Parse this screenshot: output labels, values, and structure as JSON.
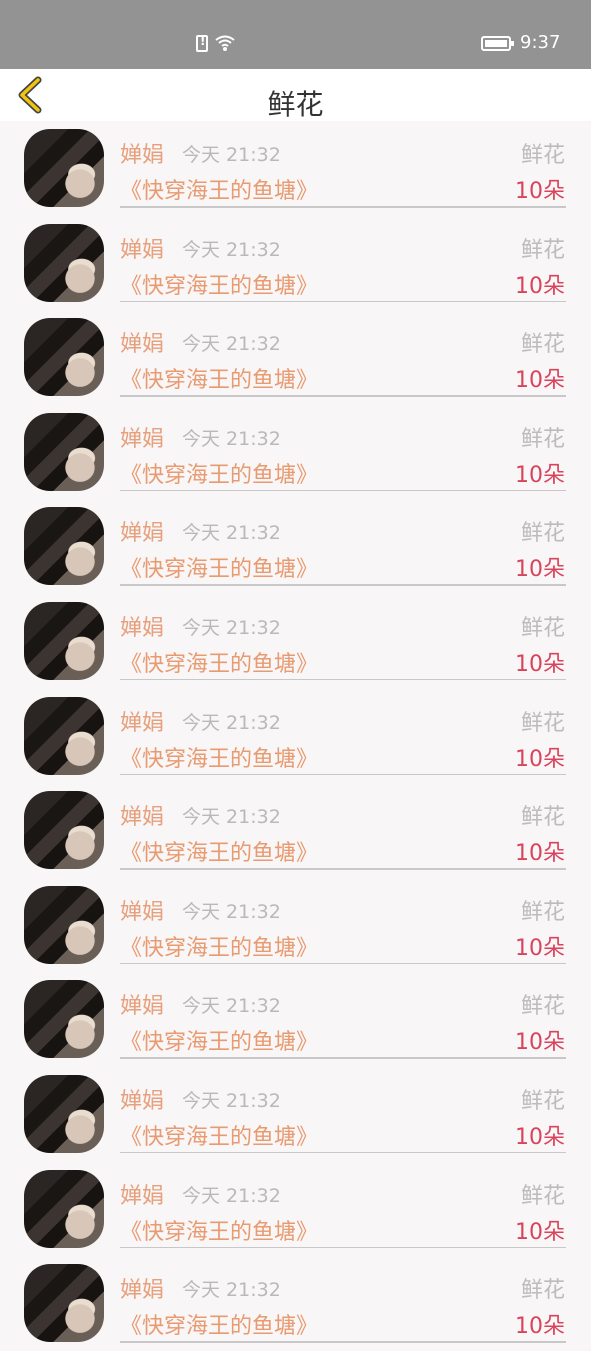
{
  "status": {
    "time": "9:37"
  },
  "header": {
    "title": "鲜花"
  },
  "list": {
    "items": [
      {
        "name": "婵娟",
        "time": "今天 21:32",
        "type": "鲜花",
        "book": "《快穿海王的鱼塘》",
        "count": "10朵"
      },
      {
        "name": "婵娟",
        "time": "今天 21:32",
        "type": "鲜花",
        "book": "《快穿海王的鱼塘》",
        "count": "10朵"
      },
      {
        "name": "婵娟",
        "time": "今天 21:32",
        "type": "鲜花",
        "book": "《快穿海王的鱼塘》",
        "count": "10朵"
      },
      {
        "name": "婵娟",
        "time": "今天 21:32",
        "type": "鲜花",
        "book": "《快穿海王的鱼塘》",
        "count": "10朵"
      },
      {
        "name": "婵娟",
        "time": "今天 21:32",
        "type": "鲜花",
        "book": "《快穿海王的鱼塘》",
        "count": "10朵"
      },
      {
        "name": "婵娟",
        "time": "今天 21:32",
        "type": "鲜花",
        "book": "《快穿海王的鱼塘》",
        "count": "10朵"
      },
      {
        "name": "婵娟",
        "time": "今天 21:32",
        "type": "鲜花",
        "book": "《快穿海王的鱼塘》",
        "count": "10朵"
      },
      {
        "name": "婵娟",
        "time": "今天 21:32",
        "type": "鲜花",
        "book": "《快穿海王的鱼塘》",
        "count": "10朵"
      },
      {
        "name": "婵娟",
        "time": "今天 21:32",
        "type": "鲜花",
        "book": "《快穿海王的鱼塘》",
        "count": "10朵"
      },
      {
        "name": "婵娟",
        "time": "今天 21:32",
        "type": "鲜花",
        "book": "《快穿海王的鱼塘》",
        "count": "10朵"
      },
      {
        "name": "婵娟",
        "time": "今天 21:32",
        "type": "鲜花",
        "book": "《快穿海王的鱼塘》",
        "count": "10朵"
      },
      {
        "name": "婵娟",
        "time": "今天 21:32",
        "type": "鲜花",
        "book": "《快穿海王的鱼塘》",
        "count": "10朵"
      },
      {
        "name": "婵娟",
        "time": "今天 21:32",
        "type": "鲜花",
        "book": "《快穿海王的鱼塘》",
        "count": "10朵"
      }
    ]
  }
}
